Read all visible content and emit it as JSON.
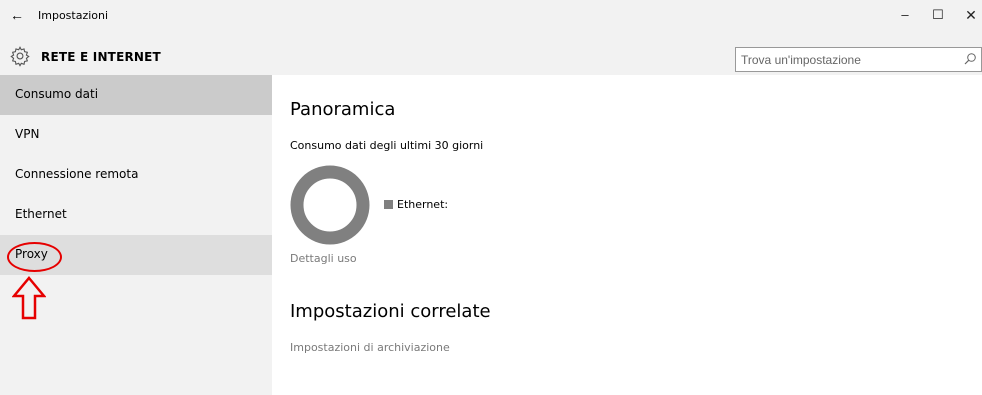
{
  "window": {
    "title": "Impostazioni",
    "back_icon": "←",
    "minimize_icon": "–",
    "maximize_icon": "☐",
    "close_icon": "✕"
  },
  "header": {
    "section_title": "RETE E INTERNET",
    "search_placeholder": "Trova un'impostazione"
  },
  "sidebar": {
    "items": [
      {
        "label": "Consumo dati",
        "state": "selected"
      },
      {
        "label": "VPN",
        "state": "normal"
      },
      {
        "label": "Connessione remota",
        "state": "normal"
      },
      {
        "label": "Ethernet",
        "state": "normal"
      },
      {
        "label": "Proxy",
        "state": "hover"
      }
    ]
  },
  "main": {
    "overview_title": "Panoramica",
    "usage_subtitle": "Consumo dati degli ultimi 30 giorni",
    "legend_label": "Ethernet:",
    "details_link": "Dettagli uso",
    "related_title": "Impostazioni correlate",
    "storage_link": "Impostazioni di archiviazione"
  },
  "colors": {
    "chrome_bg": "#f2f2f2",
    "selected_item": "#cbcbcb",
    "hover_item": "#dedede",
    "donut": "#808080",
    "annotation": "#e60000"
  }
}
